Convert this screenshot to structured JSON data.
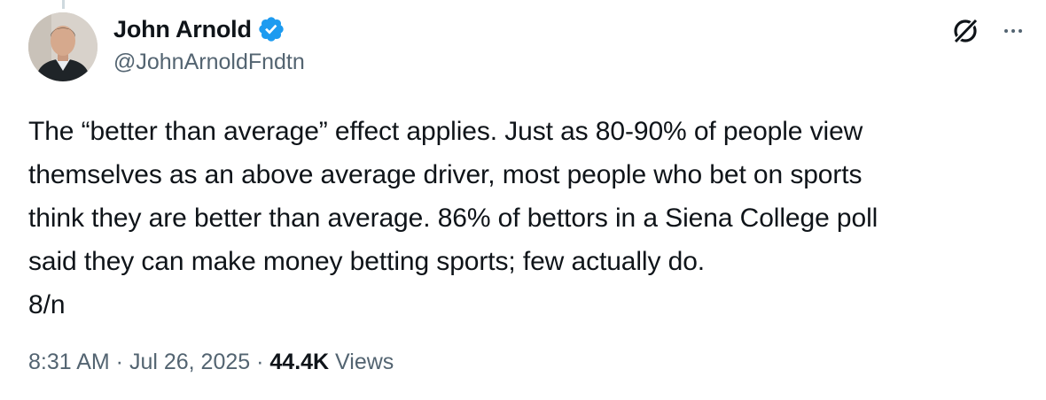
{
  "author": {
    "display_name": "John Arnold",
    "handle": "@JohnArnoldFndtn",
    "verified": true,
    "verified_color": "#1d9bf0"
  },
  "tweet": {
    "lines": [
      "The “better than average” effect applies. Just as 80-90% of people view",
      "themselves as an above average driver, most people who bet on sports",
      "think they are better than average. 86% of bettors in a Siena College poll",
      "said they can make money betting sports; few actually do.",
      "8/n"
    ]
  },
  "meta": {
    "time": "8:31 AM",
    "separator": " · ",
    "date": "Jul 26, 2025",
    "views_count": "44.4K",
    "views_label": " Views"
  },
  "icons": {
    "grok": "grok-icon",
    "more": "more-options-icon",
    "verified": "verified-badge-icon"
  },
  "colors": {
    "text": "#0f1419",
    "secondary": "#536471",
    "accent": "#1d9bf0"
  }
}
